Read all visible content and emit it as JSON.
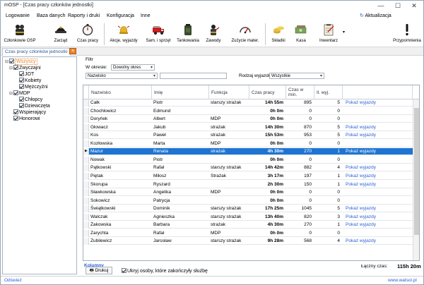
{
  "window": {
    "title": "mOSP - [Czas pracy członków jednostki]",
    "minimize": "—",
    "maximize": "☐",
    "close": "✕"
  },
  "menu": {
    "items": [
      "Logowanie",
      "Baza danych",
      "Raporty i druki",
      "Konfiguracja",
      "Inne"
    ],
    "update_label": "Aktualizacja",
    "update_icon": "update-icon"
  },
  "toolbar": {
    "buttons": [
      {
        "label": "Członkowie OSP",
        "icon": "firefighters-icon"
      },
      {
        "label": "Zarząd",
        "icon": "helmet-icon"
      },
      {
        "label": "Czas pracy",
        "icon": "stopwatch-icon"
      },
      {
        "label": "Akcje, wyjazdy",
        "icon": "alarm-bell-icon"
      },
      {
        "label": "Sam. i sprzęt",
        "icon": "fire-truck-icon"
      },
      {
        "label": "Tankowania",
        "icon": "fuel-can-icon"
      },
      {
        "label": "Zawody",
        "icon": "firefighter-icon"
      },
      {
        "label": "Zużycie mater.",
        "icon": "gauge-icon"
      },
      {
        "label": "Składki",
        "icon": "coins-icon"
      },
      {
        "label": "Kasa",
        "icon": "cash-icon"
      },
      {
        "label": "Inwentarz",
        "icon": "clipboard-icon"
      },
      {
        "label": "Przypomnienia",
        "icon": "exclamation-icon"
      }
    ]
  },
  "tab": {
    "label": "Czas pracy członków jednostki",
    "close_icon": "close-tab-icon"
  },
  "tree": {
    "root": "Wszyscy",
    "nodes": [
      {
        "label": "Zwyczajni",
        "expander": "⊟",
        "children": [
          "JOT",
          "Kobiety",
          "Mężczyźni"
        ]
      },
      {
        "label": "MDP",
        "expander": "⊟",
        "children": [
          "Chłopcy",
          "Dziewczęta"
        ]
      },
      {
        "label": "Wspierający",
        "expander": "",
        "children": []
      },
      {
        "label": "Honorowi",
        "expander": "",
        "children": []
      }
    ]
  },
  "filter": {
    "title": "Filtr",
    "range_label": "W okresie:",
    "range_value": "Dowolny okres",
    "field_value": "Nazwisko",
    "search_value": "",
    "type_label": "Rodzaj wyjazdu:",
    "type_value": "Wszystkie"
  },
  "table": {
    "columns": [
      "Nazwisko",
      "Imię",
      "Funkcja",
      "Czas pracy",
      "Czas w min.",
      "Il. wyj."
    ],
    "link_text": "Pokaż wyjazdy",
    "rows": [
      [
        "Całk",
        "Piotr",
        "starszy strażak",
        "14h 55m",
        "895",
        "5",
        true
      ],
      [
        "Chochłowicz",
        "Edmund",
        "",
        "0h 0m",
        "0",
        "0",
        false
      ],
      [
        "Doryńek",
        "Albert",
        "MDP",
        "0h 0m",
        "0",
        "0",
        false
      ],
      [
        "Głowacz",
        "Jakub",
        "strażak",
        "14h 30m",
        "870",
        "5",
        true
      ],
      [
        "Kos",
        "Paweł",
        "strażak",
        "15h 53m",
        "953",
        "5",
        true
      ],
      [
        "Kozłowska",
        "Marta",
        "MDP",
        "0h 0m",
        "0",
        "0",
        false
      ],
      [
        "Mazur",
        "Renata",
        "strażak",
        "4h 30m",
        "270",
        "1",
        true
      ],
      [
        "Nowak",
        "Piotr",
        "",
        "0h 0m",
        "0",
        "0",
        false
      ],
      [
        "Pątkowski",
        "Rafał",
        "starszy strażak",
        "14h 42m",
        "882",
        "4",
        true
      ],
      [
        "Piętak",
        "Miłosz",
        "Strażak",
        "3h 17m",
        "197",
        "1",
        true
      ],
      [
        "Skorupa",
        "Ryszard",
        "",
        "2h 30m",
        "150",
        "1",
        true
      ],
      [
        "Sławkowska",
        "Angelika",
        "MDP",
        "0h 0m",
        "0",
        "0",
        false
      ],
      [
        "Sokowicz",
        "Patrycja",
        "",
        "0h 0m",
        "0",
        "0",
        false
      ],
      [
        "Świątkowski",
        "Dominik",
        "starszy strażak",
        "17h 25m",
        "1045",
        "5",
        true
      ],
      [
        "Walczak",
        "Agnieszka",
        "starszy strażak",
        "13h 40m",
        "820",
        "3",
        true
      ],
      [
        "Żakowska",
        "Barbara",
        "strażak",
        "4h 30m",
        "270",
        "1",
        true
      ],
      [
        "Zarychta",
        "Rafał",
        "MDP",
        "0h 0m",
        "0",
        "0",
        false
      ],
      [
        "Zubilewicz",
        "Jarosław",
        "starszy strażak",
        "9h 28m",
        "568",
        "4",
        true
      ]
    ],
    "selected_index": 6,
    "row_marker": "▶"
  },
  "bottom": {
    "columns_link": "Kolumny",
    "print_button": "Drukuj",
    "print_icon": "printer-icon",
    "hide_label": "Ukryj osoby, które zakończyły służbę",
    "total_label": "Łączny czas:",
    "total_value": "115h 20m"
  },
  "footer": {
    "refresh": "Odśwież",
    "site": "www.watsol.pl"
  },
  "colors": {
    "accent": "#1e74d2",
    "link": "#2a5fd6",
    "tree_root": "#e8862e"
  }
}
